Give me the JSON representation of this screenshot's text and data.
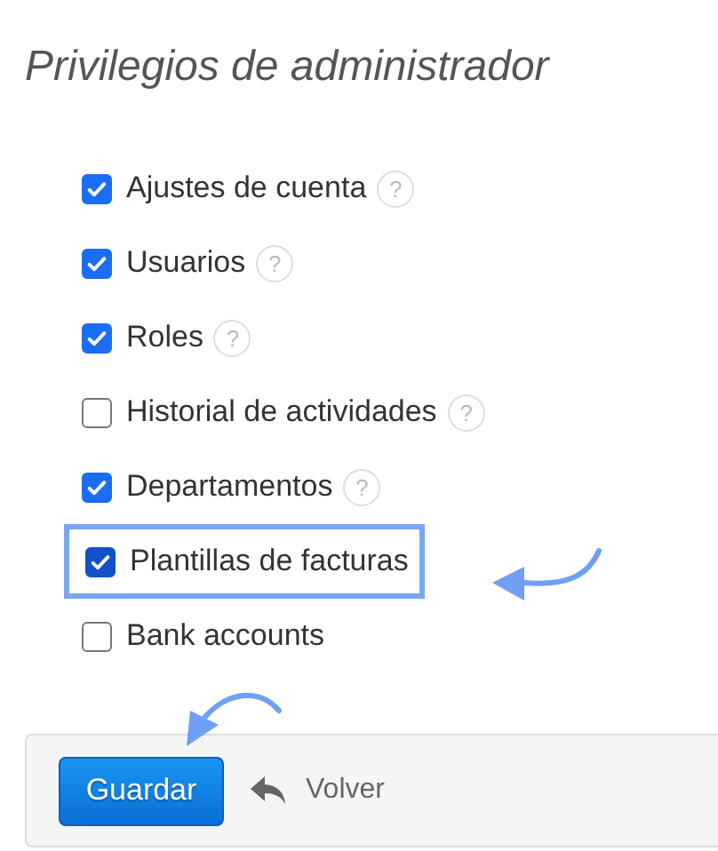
{
  "title": "Privilegios de administrador",
  "permissions": [
    {
      "label": "Ajustes de cuenta",
      "checked": true,
      "help": "?",
      "highlighted": false
    },
    {
      "label": "Usuarios",
      "checked": true,
      "help": "?",
      "highlighted": false
    },
    {
      "label": "Roles",
      "checked": true,
      "help": "?",
      "highlighted": false
    },
    {
      "label": "Historial de actividades",
      "checked": false,
      "help": "?",
      "highlighted": false
    },
    {
      "label": "Departamentos",
      "checked": true,
      "help": "?",
      "highlighted": false
    },
    {
      "label": "Plantillas de facturas",
      "checked": true,
      "highlighted": true
    },
    {
      "label": "Bank accounts",
      "checked": false,
      "highlighted": false
    }
  ],
  "footer": {
    "save_button": "Guardar",
    "back_link": "Volver"
  }
}
